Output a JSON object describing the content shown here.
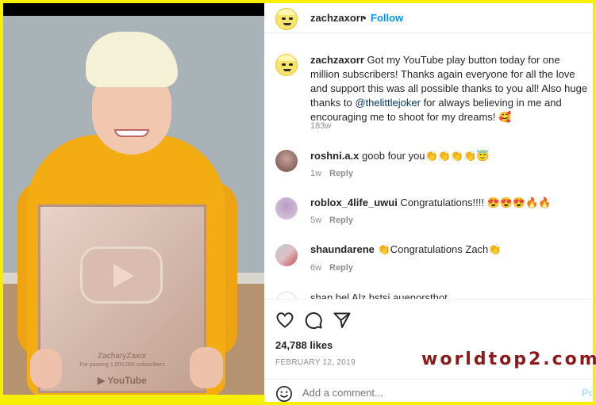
{
  "post": {
    "username": "zachzaxorr",
    "separator": "•",
    "follow_label": "Follow"
  },
  "caption": {
    "username": "zachzaxorr",
    "text_before_mention": " Got my YouTube play button today for one million subscribers! Thanks again everyone for all the love and support this was all possible thanks to you all! Also huge thanks to ",
    "mention": "@thelittlejoker",
    "text_after_mention": " for always believing in me and encouraging me to shoot for my dreams! 🥰",
    "time": "183w"
  },
  "comments": [
    {
      "username": "roshni.a.x",
      "text": " goob four you👏👏👏👏😇",
      "time": "1w",
      "reply_label": "Reply"
    },
    {
      "username": "roblox_4life_uwui",
      "text": " Congratulations!!!! 😍😍😍🔥🔥",
      "time": "5w",
      "reply_label": "Reply"
    },
    {
      "username": "shaundarene",
      "text": " 👏Congratulations Zach👏",
      "time": "6w",
      "reply_label": "Reply"
    }
  ],
  "partial_comment": "shan.hel   Alz   bstsi   auenorsthot",
  "likes": "24,788 likes",
  "date": "FEBRUARY 12, 2019",
  "add_comment": {
    "placeholder": "Add a comment...",
    "emoji_icon": "smiley-icon",
    "post_label": "Po"
  },
  "photo_plaque": {
    "name": "ZacharyZaxor",
    "subtext": "For passing 1,000,000 subscribers",
    "brand": "▶ YouTube"
  },
  "watermark": "worldtop2.com",
  "colors": {
    "follow": "#0095f6",
    "frame": "#f7ef00",
    "mention": "#00376b"
  }
}
